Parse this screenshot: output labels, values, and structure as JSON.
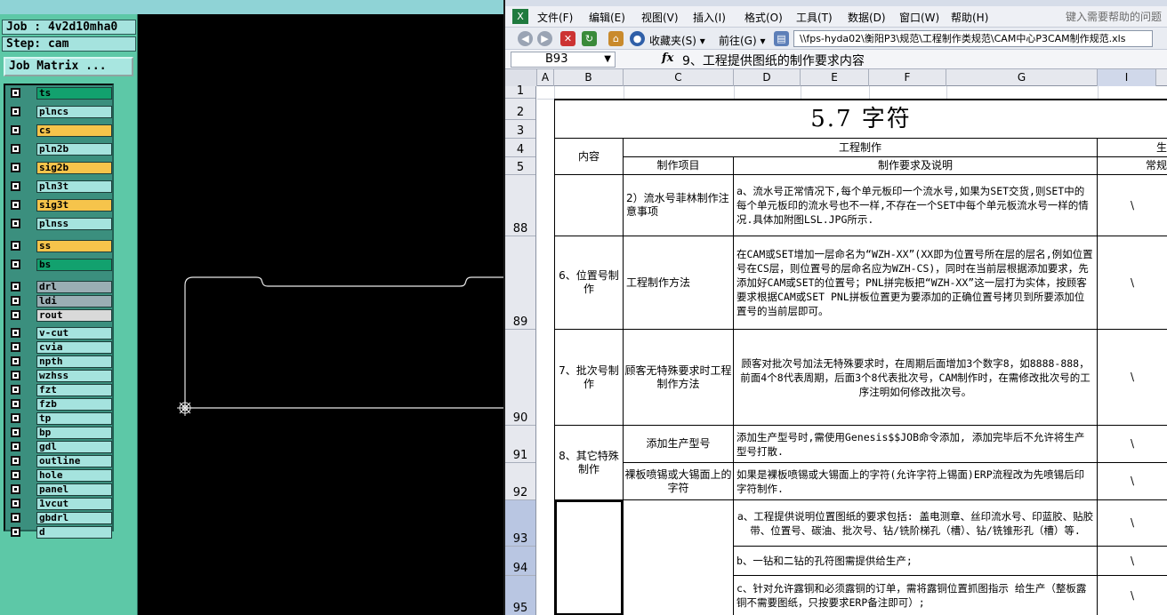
{
  "cam": {
    "job_line": "Job : 4v2d10mha0",
    "step_line": "Step: cam",
    "job_matrix_label": "Job Matrix ...",
    "layers": [
      {
        "name": "ts",
        "color": "#12a16e"
      },
      {
        "name": "plncs",
        "color": "#a5e3de"
      },
      {
        "name": "cs",
        "color": "#f6c44b"
      },
      {
        "name": "pln2b",
        "color": "#a5e3de"
      },
      {
        "name": "sig2b",
        "color": "#f6c44b"
      },
      {
        "name": "pln3t",
        "color": "#a5e3de"
      },
      {
        "name": "sig3t",
        "color": "#f6c44b"
      },
      {
        "name": "plnss",
        "color": "#a5e3de"
      },
      {
        "name": "ss",
        "color": "#f6c44b"
      },
      {
        "name": "bs",
        "color": "#12a16e"
      },
      {
        "name": "drl",
        "color": "#9aaeb4"
      },
      {
        "name": "ldi",
        "color": "#9aaeb4"
      },
      {
        "name": "rout",
        "color": "#d9d9d9"
      },
      {
        "name": "v-cut",
        "color": "#a5e3de"
      },
      {
        "name": "cvia",
        "color": "#a5e3de"
      },
      {
        "name": "npth",
        "color": "#a5e3de"
      },
      {
        "name": "wzhss",
        "color": "#a5e3de"
      },
      {
        "name": "fzt",
        "color": "#a5e3de"
      },
      {
        "name": "fzb",
        "color": "#a5e3de"
      },
      {
        "name": "tp",
        "color": "#a5e3de"
      },
      {
        "name": "bp",
        "color": "#a5e3de"
      },
      {
        "name": "gdl",
        "color": "#a5e3de"
      },
      {
        "name": "outline",
        "color": "#a5e3de"
      },
      {
        "name": "hole",
        "color": "#a5e3de"
      },
      {
        "name": "panel",
        "color": "#a5e3de"
      },
      {
        "name": "1vcut",
        "color": "#a5e3de"
      },
      {
        "name": "gbdrl",
        "color": "#a5e3de"
      },
      {
        "name": "d",
        "color": "#a5e3de"
      }
    ]
  },
  "excel": {
    "menu": [
      "文件(F)",
      "编辑(E)",
      "视图(V)",
      "插入(I)",
      "格式(O)",
      "工具(T)",
      "数据(D)",
      "窗口(W)",
      "帮助(H)"
    ],
    "help_placeholder": "键入需要帮助的问题",
    "toolbar": {
      "favorites_label": "收藏夹(S) ▾",
      "go_label": "前往(G) ▾",
      "address": "\\\\fps-hyda02\\衡阳P3\\规范\\工程制作类规范\\CAM中心P3CAM制作规范.xls"
    },
    "name_box": "B93",
    "fx_label": "fx",
    "formula": "9、工程提供图纸的制作要求内容",
    "columns": [
      "A",
      "B",
      "C",
      "D",
      "E",
      "F",
      "G",
      "I"
    ],
    "rows": [
      "1",
      "2",
      "3",
      "4",
      "5",
      "88",
      "89",
      "90",
      "91",
      "92",
      "93",
      "94",
      "95"
    ],
    "sheet": {
      "title": "5.7 字符",
      "header_content": "内容",
      "header_eng": "工程制作",
      "header_item": "制作项目",
      "header_req": "制作要求及说明",
      "header_right_top": "生",
      "header_right_sub": "常规",
      "r88_item": "2）流水号菲林制作注意事项",
      "r88_req": "a、流水号正常情况下,每个单元板印一个流水号,如果为SET交货,则SET中的每个单元板印的流水号也不一样,不存在一个SET中每个单元板流水号一样的情况.具体加附图LSL.JPG所示.",
      "r89_content": "6、位置号制作",
      "r89_item": "工程制作方法",
      "r89_req": "在CAM或SET增加一层命名为“WZH-XX”(XX即为位置号所在层的层名,例如位置号在CS层，则位置号的层命名应为WZH-CS)，同时在当前层根据添加要求，先添加好CAM或SET的位置号；PNL拼完板把“WZH-XX”这一层打为实体，按顾客要求根据CAM或SET PNL拼板位置更为要添加的正确位置号拷贝到所要添加位置号的当前层即可。",
      "r90_content": "7、批次号制作",
      "r90_item": "顾客无特殊要求时工程制作方法",
      "r90_req": "顾客对批次号加法无特殊要求时，在周期后面增加3个数字8，如8888-888，前面4个8代表周期，后面3个8代表批次号，CAM制作时，在需修改批次号的工序注明如何修改批次号。",
      "r91_content": "8、其它特殊制作",
      "r91_item": "添加生产型号",
      "r91_req": "添加生产型号时,需使用Genesis$$JOB命令添加, 添加完毕后不允许将生产型号打散.",
      "r92_item": "裸板喷锡或大锡面上的字符",
      "r92_req": "如果是裸板喷锡或大锡面上的字符(允许字符上锡面)ERP流程改为先喷锡后印字符制作.",
      "r93_req": "a、工程提供说明位置图纸的要求包括:  盖电测章、丝印流水号、印蓝胶、贴胶带、位置号、碳油、批次号、钻/铣阶梯孔（槽）、钻/铣锥形孔（槽）等.",
      "r94_req": "b、一钻和二钻的孔符图需提供给生产;",
      "r95_req": "c、针对允许露铜和必须露铜的订单，需将露铜位置抓图指示 给生产（整板露铜不需要图纸，只按要求ERP备注即可）;",
      "slash": "\\"
    }
  }
}
